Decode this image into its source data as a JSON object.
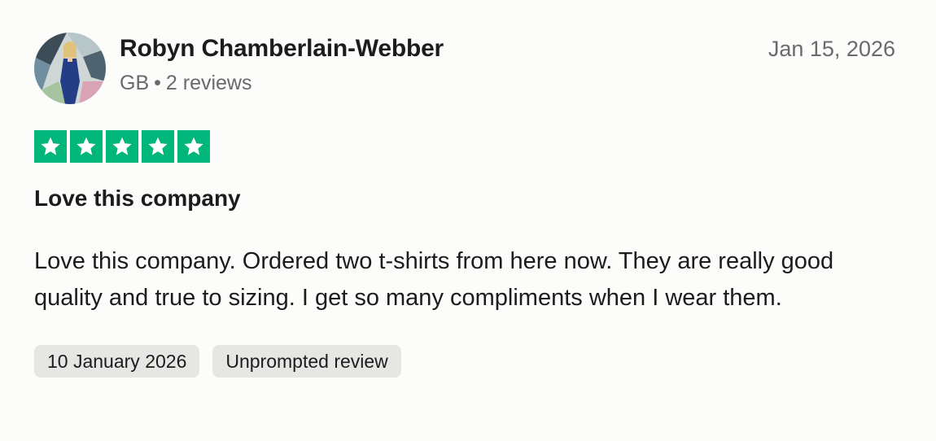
{
  "review": {
    "reviewer_name": "Robyn Chamberlain-Webber",
    "country": "GB",
    "separator": "•",
    "review_count": "2 reviews",
    "posted_date": "Jan 15, 2026",
    "rating": 5,
    "rating_max": 5,
    "title": "Love this company",
    "body": "Love this company. Ordered two t-shirts from here now. They are really good quality and true to sizing. I get so many compliments when I wear them.",
    "experience_date": "10 January 2026",
    "review_type": "Unprompted review"
  },
  "colors": {
    "star_fill": "#00b67a",
    "star_glyph": "#ffffff",
    "muted_text": "#696a6a",
    "tag_bg": "#e6e6e4"
  },
  "icons": {
    "star": "star-icon",
    "avatar": "avatar-photo"
  }
}
